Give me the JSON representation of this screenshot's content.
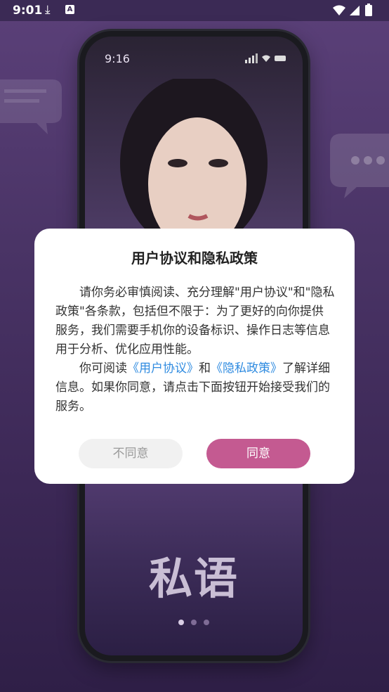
{
  "status_bar": {
    "time": "9:01"
  },
  "phone_preview": {
    "time": "9:16",
    "brand": "私语",
    "page_dots": 3,
    "active_dot": 0
  },
  "dialog": {
    "title": "用户协议和隐私政策",
    "paragraph1": "请你务必审慎阅读、充分理解\"用户协议\"和\"隐私政策\"各条款，包括但不限于：为了更好的向你提供服务，我们需要手机你的设备标识、操作日志等信息用于分析、优化应用性能。",
    "p2_prefix": "你可阅读",
    "user_agreement_link": "《用户协议》",
    "p2_and": "和",
    "privacy_policy_link": "《隐私政策》",
    "p2_suffix": "了解详细信息。如果你同意，请点击下面按钮开始接受我们的服务。",
    "disagree_label": "不同意",
    "agree_label": "同意"
  },
  "colors": {
    "accent": "#c45a91",
    "link": "#2f8be0",
    "background": "#4a3466"
  }
}
